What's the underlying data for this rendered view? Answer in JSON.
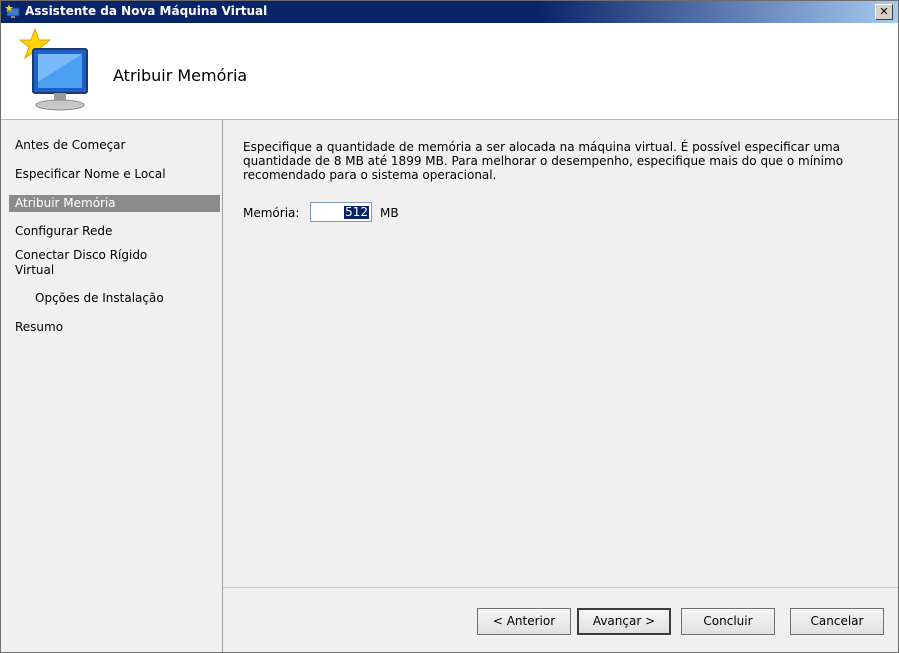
{
  "window": {
    "title": "Assistente da Nova Máquina Virtual",
    "close_label": "✕"
  },
  "header": {
    "title": "Atribuir Memória"
  },
  "nav": {
    "items": [
      {
        "label": "Antes de Começar",
        "active": false
      },
      {
        "label": "Especificar Nome e Local",
        "active": false
      },
      {
        "label": "Atribuir Memória",
        "active": true
      },
      {
        "label": "Configurar Rede",
        "active": false
      },
      {
        "label": "Conectar Disco Rígido Virtual",
        "active": false
      },
      {
        "label": "Opções de Instalação",
        "active": false
      },
      {
        "label": "Resumo",
        "active": false
      }
    ]
  },
  "content": {
    "description": "Especifique a quantidade de memória a ser alocada na máquina virtual. É possível especificar uma quantidade de 8 MB até 1899 MB. Para melhorar o desempenho, especifique mais do que o mínimo recomendado para o sistema operacional.",
    "memory_label": "Memória:",
    "memory_value": "512",
    "memory_unit": "MB"
  },
  "buttons": {
    "previous": "< Anterior",
    "next": "Avançar >",
    "finish": "Concluir",
    "cancel": "Cancelar"
  },
  "icons": {
    "title": "new-vm-wizard-icon",
    "header": "computer-with-star-icon"
  }
}
